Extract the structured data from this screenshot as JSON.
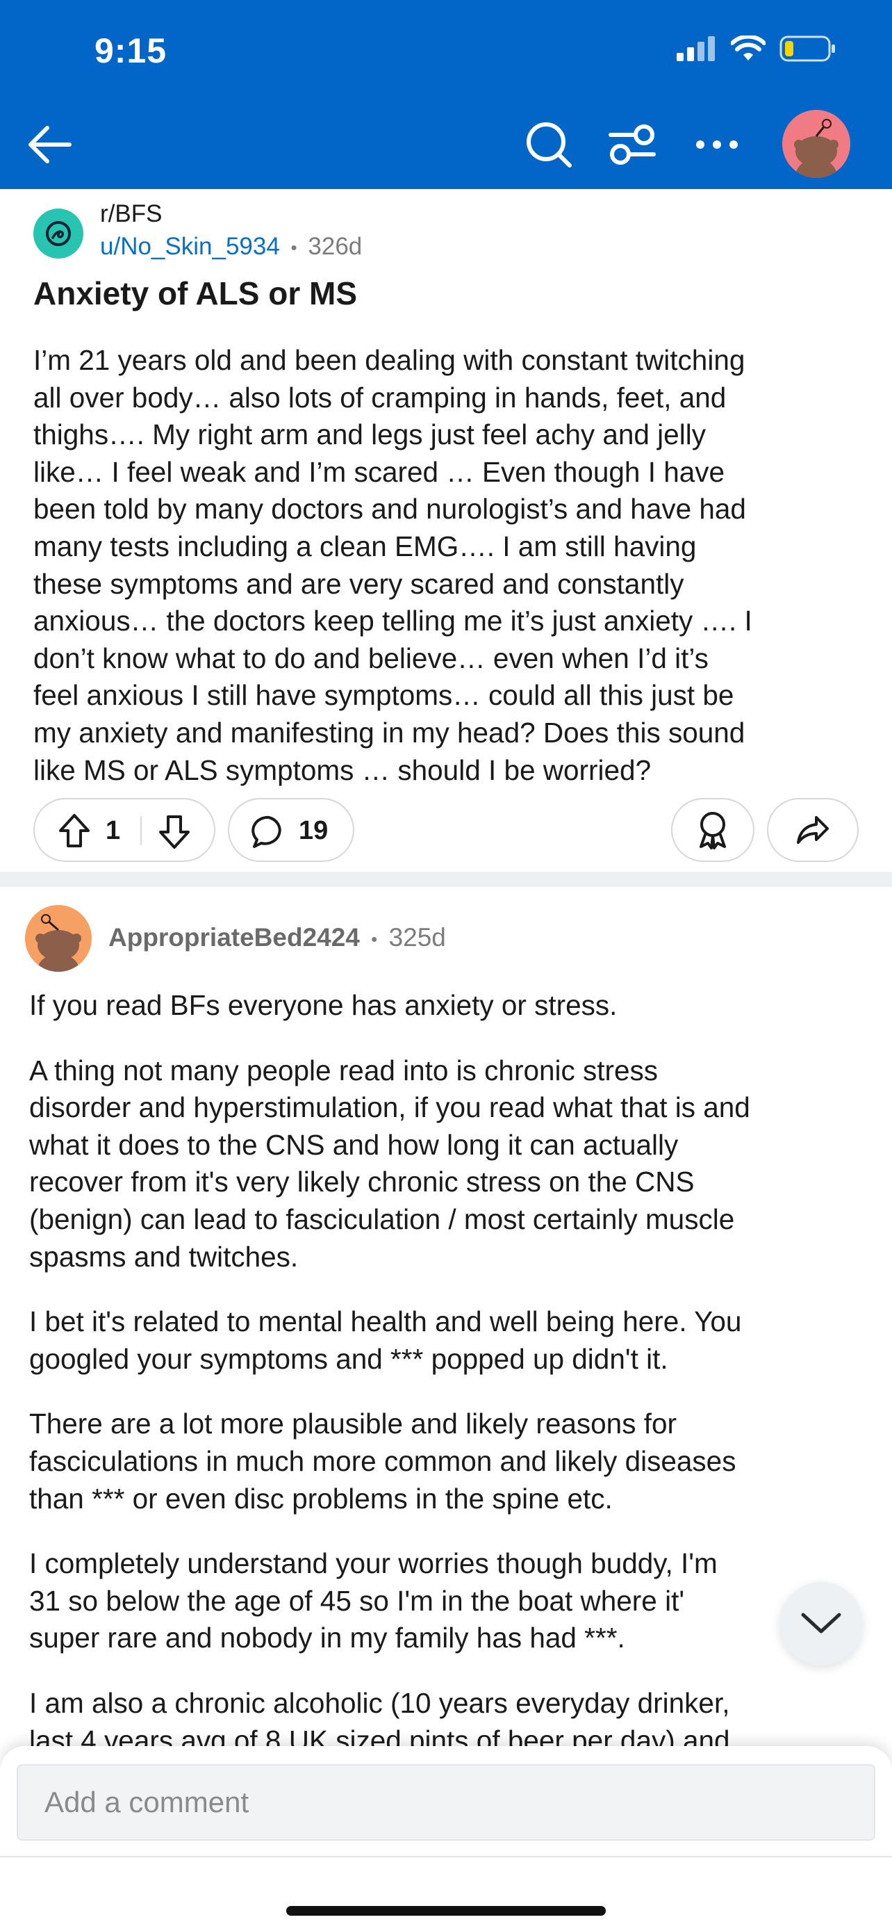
{
  "status_bar": {
    "time": "9:15"
  },
  "nav": {
    "back_icon": "arrow-left-icon",
    "search_icon": "search-icon",
    "filter_icon": "sort-options-icon",
    "more_icon": "more-horizontal-icon"
  },
  "post": {
    "subreddit": "r/BFS",
    "author": "u/No_Skin_5934",
    "separator": "•",
    "age": "326d",
    "title": "Anxiety of ALS or MS",
    "body_lines": [
      "I’m 21 years old and been dealing with constant twitching",
      "all over body… also lots of cramping in hands, feet, and",
      "thighs…. My right arm and legs just feel achy and jelly",
      "like… I feel weak and I’m scared … Even though I have",
      "been told by many doctors and nurologist’s and have had",
      "many tests including a clean EMG…. I am still having",
      "these symptoms and are very scared and constantly",
      "anxious… the doctors keep telling me it’s just anxiety …. I",
      "don’t know what to do and believe… even when I’d it’s",
      "feel anxious I still have symptoms… could all this just be",
      "my anxiety and manifesting in my head? Does this sound",
      "like MS or ALS symptoms … should I be worried?"
    ],
    "votes": "1",
    "comments": "19"
  },
  "comment": {
    "author": "AppropriateBed2424",
    "separator": "•",
    "age": "325d",
    "paragraphs": [
      [
        "If you read BFs everyone has anxiety or stress."
      ],
      [
        "A thing not many people read into is chronic stress",
        "disorder and hyperstimulation, if you read what that is and",
        "what it does to the CNS and how long it can actually",
        "recover from it's very likely chronic stress on the CNS",
        "(benign) can lead to fasciculation / most certainly muscle",
        "spasms and twitches."
      ],
      [
        "I bet it's related to mental health and well being here. You",
        "googled your symptoms and *** popped up didn't it."
      ],
      [
        "There are a lot more plausible and likely reasons for",
        "fasciculations in much more common and likely diseases",
        "than *** or even disc problems in the spine etc."
      ],
      [
        "I completely understand your worries though buddy, I'm",
        "31 so below the age of 45 so I'm in the boat where it'",
        "super rare and nobody in my family has had ***."
      ],
      [
        "I am also a chronic alcoholic (10 years everyday drinker,",
        "last 4 years avg of 8 UK sized pints of beer per day) and"
      ]
    ]
  },
  "composer": {
    "placeholder": "Add a comment"
  },
  "colors": {
    "header": "#0266c8",
    "link": "#0a6fc2",
    "subreddit_icon": "#27c4b2",
    "avatar_top": "#f17b85",
    "comment_avatar": "#f6a063"
  }
}
